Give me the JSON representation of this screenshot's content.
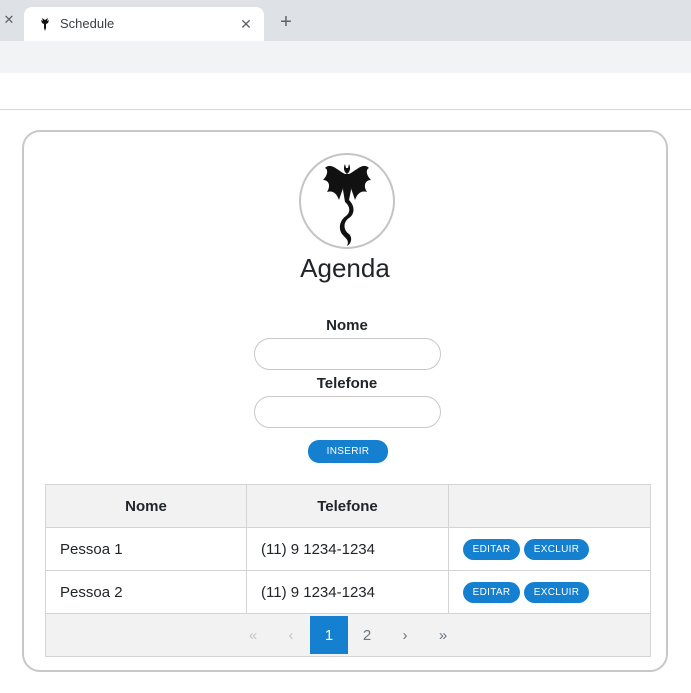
{
  "browser": {
    "tab_title": "Schedule",
    "prev_tab_close": "✕",
    "tab_close": "✕",
    "new_tab": "+"
  },
  "app": {
    "title": "Agenda",
    "form": {
      "name_label": "Nome",
      "name_value": "",
      "phone_label": "Telefone",
      "phone_value": "",
      "insert_label": "INSERIR"
    },
    "table": {
      "columns": [
        "Nome",
        "Telefone",
        ""
      ],
      "rows": [
        {
          "name": "Pessoa 1",
          "phone": "(11) 9 1234-1234",
          "edit": "EDITAR",
          "delete": "EXCLUIR"
        },
        {
          "name": "Pessoa 2",
          "phone": "(11) 9 1234-1234",
          "edit": "EDITAR",
          "delete": "EXCLUIR"
        }
      ]
    },
    "pagination": {
      "first": "«",
      "prev": "‹",
      "pages": [
        "1",
        "2"
      ],
      "current_page": "1",
      "next": "›",
      "last": "»"
    },
    "accent_color": "#1580d0",
    "avatar_icon": "dragon-icon"
  }
}
